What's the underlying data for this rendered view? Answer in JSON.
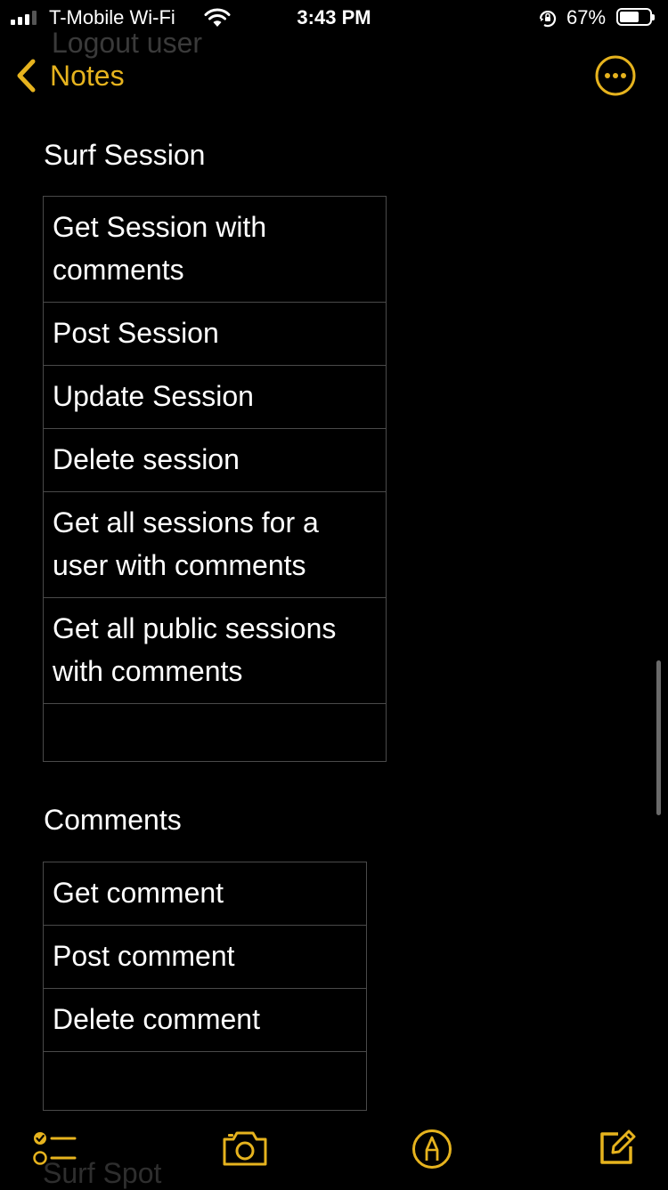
{
  "status_bar": {
    "carrier": "T-Mobile Wi-Fi",
    "time": "3:43 PM",
    "battery_percent": "67%",
    "battery_level": 0.67,
    "signal_bars": 3,
    "icons": [
      "signal-icon",
      "wifi-icon",
      "rotation-lock-icon",
      "battery-icon"
    ]
  },
  "nav": {
    "back_label": "Notes",
    "back_icon": "chevron-left-icon",
    "more_icon": "more-options-icon",
    "accent_color": "#e6b31e"
  },
  "ghost_text": {
    "top": "Logout user",
    "bottom": "Surf Spot"
  },
  "sections": [
    {
      "heading": "Surf Session",
      "rows": [
        "Get Session with comments",
        "Post Session",
        "Update Session",
        "Delete session",
        "Get all sessions for a user with comments",
        "Get all public sessions with comments",
        ""
      ]
    },
    {
      "heading": "Comments",
      "rows": [
        "Get comment",
        "Post comment",
        "Delete comment",
        ""
      ]
    }
  ],
  "toolbar": {
    "icons": [
      "checklist-icon",
      "camera-icon",
      "markup-icon",
      "compose-icon"
    ]
  },
  "colors": {
    "background": "#000000",
    "text": "#ffffff",
    "accent": "#e6b31e",
    "table_border": "#4a4a4a"
  }
}
